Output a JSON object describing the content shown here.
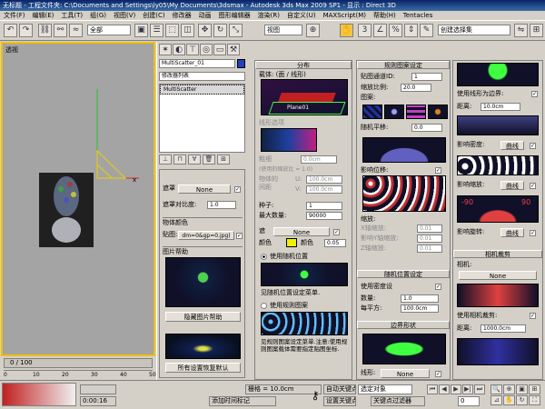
{
  "window": {
    "title": "无标题  - 工程文件夹: C:\\Documents and Settings\\ly05\\My Documents\\3dsmax  - Autodesk 3ds Max 2009 SP1  - 显示 : Direct 3D"
  },
  "menu": [
    "文件(F)",
    "编辑(E)",
    "工具(T)",
    "组(G)",
    "视图(V)",
    "创建(C)",
    "修改器",
    "动画",
    "图形编辑器",
    "渲染(R)",
    "自定义(U)",
    "MAXScript(M)",
    "帮助(H)",
    "Tentacles"
  ],
  "toolbar": {
    "selection_filter": "全部",
    "ref_coord": "视图",
    "named_selection": "创建选择集"
  },
  "viewport": {
    "label": "透视"
  },
  "cmd": {
    "object_name": "MultiScatter_01",
    "modifier_list": "修改器列表",
    "stack_item": "MultiScatter",
    "distribution_label": "遮罩",
    "distribution_value": "None",
    "mask_ratio_label": "遮罩对比度:",
    "mask_ratio_value": "1.0",
    "object_color_header": "物体颜色",
    "map_label": "贴图:",
    "map_value": "dm=0&gp=0.jpg)",
    "help_header": "图片帮助",
    "hide_help_btn": "隐藏图片帮助",
    "reset_all_btn": "所有设置恢复默认"
  },
  "col1": {
    "header": "分布",
    "carrier_label": "载体: (面 / 线形)",
    "carrier_btn": "Plane01",
    "line_options": "线形选项",
    "thickness": "粗细",
    "thickness_val": "0.0cm",
    "use_scale_note": "(使用的缩放比 = 1.0)",
    "object_label": "物体的",
    "interval_label": "间距",
    "u_label": "U:",
    "u_val": "100.0cm",
    "v_label": "V:",
    "v_val": "100.0cm",
    "seed_label": "种子:",
    "seed_val": "1",
    "max_count_label": "最大数量:",
    "max_count_val": "90000",
    "dist_label": "遮",
    "dist_val": "None",
    "color_label": "颜色",
    "color_pick_label": "颜色",
    "color_val": "0.05",
    "random_pos": "使用随机位置",
    "random_pos_note": "见随机位置设定菜单.",
    "use_pattern": "使用规则图案",
    "pattern_note": "见规则图案设定菜单.注意:使用规则图案载体需要指定贴图坐标."
  },
  "col2": {
    "header": "规则图案设定",
    "map_channel_label": "贴图通道ID:",
    "map_channel_val": "1",
    "scale_label": "缩放比例:",
    "scale_val": "20.0",
    "pattern_label": "图案:",
    "random_offset_label": "随机平移:",
    "random_offset_val": "0.0",
    "affect_pos_label": "影响位移:",
    "scale2_label": "缩放:",
    "x_label": "X轴缩放:",
    "x_val": "0.01",
    "y_label": "影响Y轴缩放:",
    "y_val": "0.01",
    "z_label": "Z轴缩放:",
    "z_val": "0.01",
    "random_pos_header": "随机位置设定",
    "use_density": "使用密度设",
    "count_label": "数量:",
    "count_val": "1.0",
    "per_unit_label": "每平方:",
    "per_unit_val": "100.0cm",
    "boundary_header": "边界形状",
    "shape_label": "线形:",
    "shape_val": "None"
  },
  "col3": {
    "use_line_boundary": "使用线形为边界:",
    "distance_label": "距离:",
    "distance_val": "10.0cm",
    "affect_density": "影响密度:",
    "curve_btn": "曲线",
    "affect_scale": "影响缩放:",
    "affect_rotation": "影响旋转:",
    "rot_neg": "-90",
    "rot_pos": "90",
    "camera_header": "相机裁剪",
    "camera_label": "相机:",
    "camera_val": "None",
    "use_camera_clip": "使用相机裁剪:",
    "distance2_val": "1000.0cm"
  },
  "timeline": {
    "frame": "0 / 100",
    "ticks": [
      "0",
      "10",
      "20",
      "30",
      "40",
      "50"
    ]
  },
  "status": {
    "grid": "栅格 = 10.0cm",
    "auto_key": "自动关键点",
    "selected": "选定对象",
    "set_key": "设置关键点",
    "key_filter": "关键点过滤器",
    "add_time_tag": "添加时间标记",
    "time": "0:00:16",
    "frame_val": "0"
  }
}
